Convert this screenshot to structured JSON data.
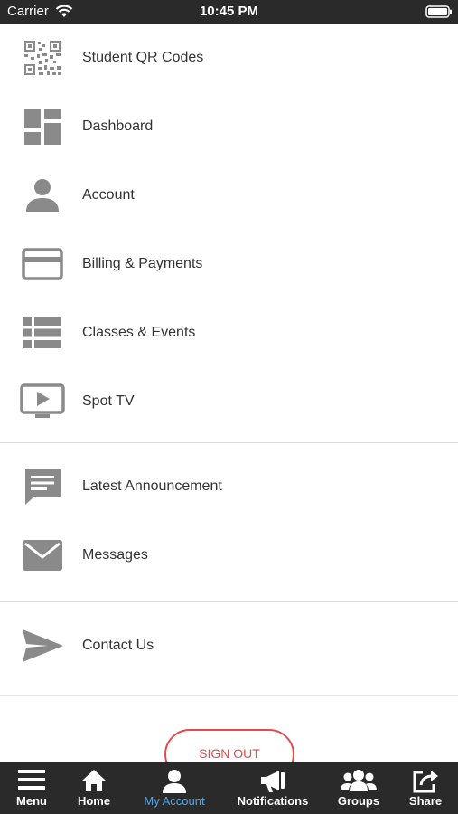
{
  "status_bar": {
    "carrier": "Carrier",
    "time": "10:45 PM"
  },
  "menu": {
    "group1": [
      {
        "label": "Student QR Codes",
        "icon": "qr-code-icon"
      },
      {
        "label": "Dashboard",
        "icon": "dashboard-icon"
      },
      {
        "label": "Account",
        "icon": "person-icon"
      },
      {
        "label": "Billing & Payments",
        "icon": "credit-card-icon"
      },
      {
        "label": "Classes & Events",
        "icon": "list-icon"
      },
      {
        "label": "Spot TV",
        "icon": "tv-play-icon"
      }
    ],
    "group2": [
      {
        "label": "Latest Announcement",
        "icon": "chat-bubble-icon"
      },
      {
        "label": "Messages",
        "icon": "envelope-icon"
      }
    ],
    "group3": [
      {
        "label": "Contact Us",
        "icon": "send-icon"
      }
    ]
  },
  "sign_out_label": "SIGN OUT",
  "tab_bar": {
    "tabs": [
      {
        "label": "Menu",
        "icon": "hamburger-menu-icon"
      },
      {
        "label": "Home",
        "icon": "home-icon"
      },
      {
        "label": "My Account",
        "icon": "account-icon",
        "active": true
      },
      {
        "label": "Notifications",
        "icon": "megaphone-icon"
      },
      {
        "label": "Groups",
        "icon": "groups-icon"
      },
      {
        "label": "Share",
        "icon": "share-icon"
      }
    ]
  },
  "colors": {
    "accent": "#4aa8f0",
    "sign_out": "#e34b4b",
    "icon_gray": "#8a8a8a",
    "bar": "#2a2a2a"
  }
}
